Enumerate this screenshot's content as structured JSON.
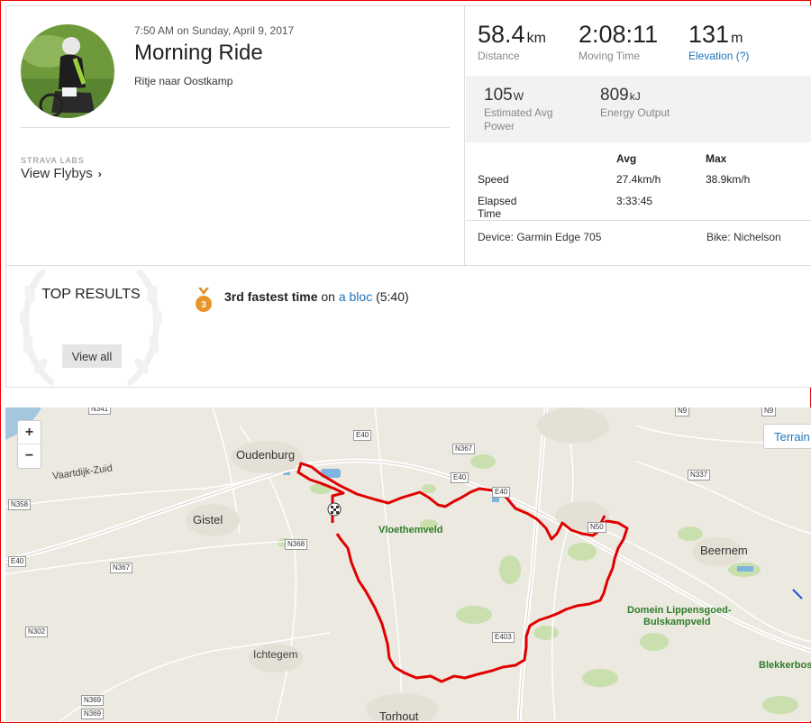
{
  "activity": {
    "datetime": "7:50 AM on Sunday, April 9, 2017",
    "title": "Morning Ride",
    "description": "Ritje naar Oostkamp"
  },
  "flyby": {
    "tag": "STRAVA LABS",
    "link_label": "View Flybys",
    "chevron": "›"
  },
  "stats": {
    "distance": {
      "value": "58.4",
      "unit": "km",
      "label": "Distance"
    },
    "moving_time": {
      "value": "2:08:11",
      "label": "Moving Time"
    },
    "elevation": {
      "value": "131",
      "unit": "m",
      "label": "Elevation (?)"
    },
    "power": {
      "value": "105",
      "unit": "W",
      "label": "Estimated Avg Power"
    },
    "energy": {
      "value": "809",
      "unit": "kJ",
      "label": "Energy Output"
    },
    "table": {
      "headers": [
        "",
        "Avg",
        "Max"
      ],
      "rows": [
        [
          "Speed",
          "27.4km/h",
          "38.9km/h"
        ],
        [
          "Elapsed Time",
          "3:33:45",
          ""
        ]
      ]
    },
    "device": "Device: Garmin Edge 705",
    "bike": "Bike: Nichelson"
  },
  "top_results": {
    "title": "TOP RESULTS",
    "view_all": "View all",
    "medal_rank": "3",
    "achievement": {
      "bold": "3rd fastest time",
      "pre_link": " on ",
      "segment": "a bloc",
      "time": " (5:40)"
    }
  },
  "map": {
    "zoom_in": "+",
    "zoom_out": "−",
    "terrain_button": "Terrain",
    "route_color": "#e00000",
    "labels": {
      "oudenburg": "Oudenburg",
      "vaartdijk": "Vaartdijk-Zuid",
      "gistel": "Gistel",
      "vloethemveld": "Vloethemveld",
      "beernem": "Beernem",
      "domein": "Domein Lippensgoed-",
      "bulskampveld": "Bulskampveld",
      "ichtegem": "Ichtegem",
      "torhout": "Torhout",
      "blekkerbos": "Blekkerbos"
    },
    "road_tags": {
      "n341": "N341",
      "e40_a": "E40",
      "n367_a": "N367",
      "e40_b": "E40",
      "e40_c": "E40",
      "n9_a": "N9",
      "n9_b": "N9",
      "n337": "N337",
      "n358": "N358",
      "e40_d": "E40",
      "n367_b": "N367",
      "n368": "N368",
      "n50": "N50",
      "n302": "N302",
      "e403": "E403",
      "n369_a": "N369",
      "n369_b": "N369"
    }
  }
}
